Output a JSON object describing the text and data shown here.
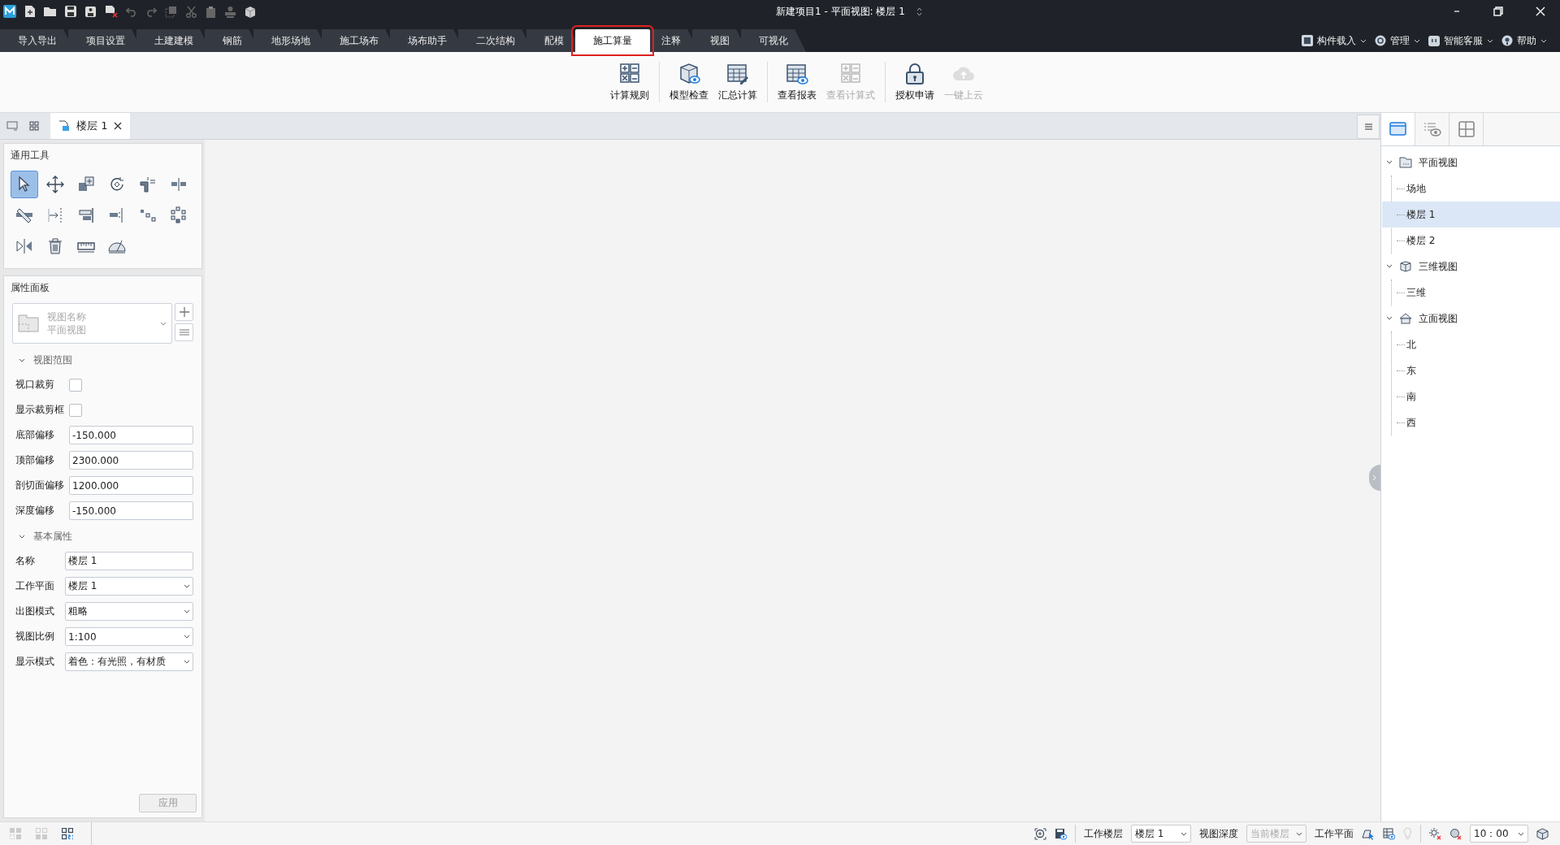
{
  "window": {
    "title": "新建项目1 - 平面视图: 楼层 1"
  },
  "menu_tabs": [
    {
      "label": "导入导出",
      "selected": false
    },
    {
      "label": "项目设置",
      "selected": false
    },
    {
      "label": "土建建模",
      "selected": false
    },
    {
      "label": "钢筋",
      "selected": false
    },
    {
      "label": "地形场地",
      "selected": false
    },
    {
      "label": "施工场布",
      "selected": false
    },
    {
      "label": "场布助手",
      "selected": false
    },
    {
      "label": "二次结构",
      "selected": false
    },
    {
      "label": "配模",
      "selected": false
    },
    {
      "label": "施工算量",
      "selected": true
    },
    {
      "label": "注释",
      "selected": false
    },
    {
      "label": "视图",
      "selected": false
    },
    {
      "label": "可视化",
      "selected": false
    }
  ],
  "menu_right": [
    {
      "kind": "component",
      "label": "构件载入"
    },
    {
      "kind": "manage",
      "label": "管理"
    },
    {
      "kind": "service",
      "label": "智能客服"
    },
    {
      "kind": "help",
      "label": "帮助"
    }
  ],
  "ribbon_groups": [
    {
      "buttons": [
        {
          "kind": "rules",
          "label": "计算规则",
          "disabled": false
        }
      ]
    },
    {
      "buttons": [
        {
          "kind": "check",
          "label": "模型检查",
          "disabled": false
        },
        {
          "kind": "summary",
          "label": "汇总计算",
          "disabled": false
        }
      ]
    },
    {
      "buttons": [
        {
          "kind": "report",
          "label": "查看报表",
          "disabled": false
        },
        {
          "kind": "formula",
          "label": "查看计算式",
          "disabled": true
        }
      ]
    },
    {
      "buttons": [
        {
          "kind": "license",
          "label": "授权申请",
          "disabled": false
        },
        {
          "kind": "cloud",
          "label": "一键上云",
          "disabled": true
        }
      ]
    }
  ],
  "doc_tabs": [
    {
      "label": "楼层 1",
      "selected": true
    }
  ],
  "tools_panel": {
    "title": "通用工具",
    "tools": [
      {
        "kind": "select",
        "selected": true
      },
      {
        "kind": "move",
        "selected": false
      },
      {
        "kind": "copy",
        "selected": false
      },
      {
        "kind": "rotate",
        "selected": false
      },
      {
        "kind": "trim",
        "selected": false
      },
      {
        "kind": "split",
        "selected": false
      },
      {
        "kind": "offset",
        "selected": false
      },
      {
        "kind": "extend",
        "selected": false
      },
      {
        "kind": "align",
        "selected": false
      },
      {
        "kind": "cut",
        "selected": false
      },
      {
        "kind": "array",
        "selected": false
      },
      {
        "kind": "group",
        "selected": false
      },
      {
        "kind": "mirror",
        "selected": false
      },
      {
        "kind": "delete",
        "selected": false
      },
      {
        "kind": "measure",
        "selected": false
      },
      {
        "kind": "angle",
        "selected": false
      }
    ]
  },
  "properties_panel": {
    "title": "属性面板",
    "type_selector": {
      "label": "视图名称",
      "value": "平面视图"
    },
    "sections": [
      {
        "title": "视图范围",
        "expanded": true,
        "rows": [
          {
            "kind": "checkbox",
            "label": "视口裁剪",
            "checked": false
          },
          {
            "kind": "checkbox",
            "label": "显示裁剪框",
            "checked": false
          },
          {
            "kind": "input",
            "label": "底部偏移",
            "value": "-150.000"
          },
          {
            "kind": "input",
            "label": "顶部偏移",
            "value": "2300.000"
          },
          {
            "kind": "input",
            "label": "剖切面偏移",
            "value": "1200.000"
          },
          {
            "kind": "input",
            "label": "深度偏移",
            "value": "-150.000"
          }
        ]
      },
      {
        "title": "基本属性",
        "expanded": true,
        "rows": [
          {
            "kind": "input",
            "label": "名称",
            "value": "楼层 1"
          },
          {
            "kind": "select",
            "label": "工作平面",
            "value": "楼层 1"
          },
          {
            "kind": "select",
            "label": "出图模式",
            "value": "粗略"
          },
          {
            "kind": "select",
            "label": "视图比例",
            "value": "1:100"
          },
          {
            "kind": "select",
            "label": "显示模式",
            "value": "着色：有光照，有材质"
          }
        ]
      }
    ],
    "apply_button": {
      "label": "应用",
      "disabled": true
    }
  },
  "browser_tabs": [
    {
      "kind": "views",
      "selected": true
    },
    {
      "kind": "visibility",
      "selected": false
    },
    {
      "kind": "layout",
      "selected": false
    }
  ],
  "project_tree": [
    {
      "kind": "plan",
      "label": "平面视图",
      "expanded": true,
      "selected": false,
      "children": [
        {
          "label": "场地",
          "selected": false
        },
        {
          "label": "楼层 1",
          "selected": true
        },
        {
          "label": "楼层 2",
          "selected": false
        }
      ]
    },
    {
      "kind": "cube",
      "label": "三维视图",
      "expanded": true,
      "selected": false,
      "children": [
        {
          "label": "三维",
          "selected": false
        }
      ]
    },
    {
      "kind": "elevation",
      "label": "立面视图",
      "expanded": true,
      "selected": false,
      "children": [
        {
          "label": "北",
          "selected": false
        },
        {
          "label": "东",
          "selected": false
        },
        {
          "label": "南",
          "selected": false
        },
        {
          "label": "西",
          "selected": false
        }
      ]
    }
  ],
  "status_bar": {
    "fields": [
      {
        "label": "工作楼层",
        "value": "楼层 1",
        "disabled": false
      },
      {
        "label": "视图深度",
        "value": "当前楼层",
        "disabled": true
      }
    ],
    "work_plane_label": "工作平面",
    "time": "10：00"
  }
}
